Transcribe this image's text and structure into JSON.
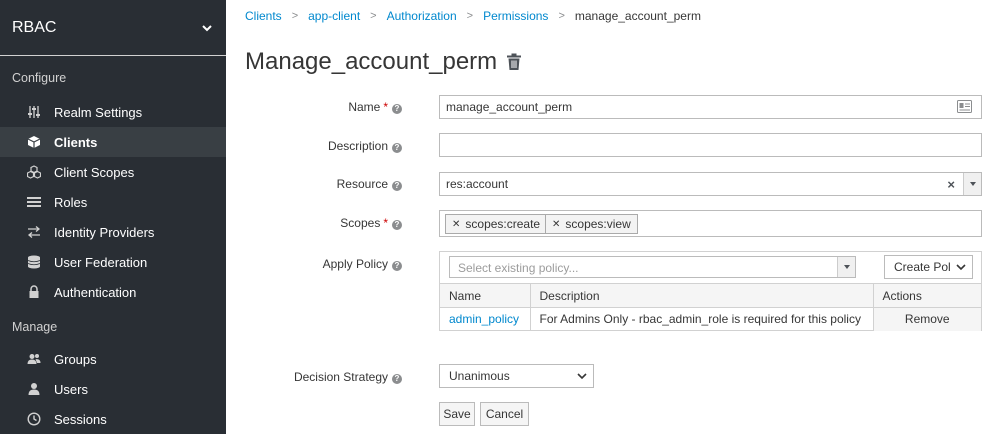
{
  "sidebar": {
    "realm_name": "RBAC",
    "sections": [
      {
        "label": "Configure"
      },
      {
        "label": "Manage"
      }
    ],
    "configure_items": [
      {
        "label": "Realm Settings",
        "icon": "sliders-icon"
      },
      {
        "label": "Clients",
        "icon": "cube-icon",
        "active": true
      },
      {
        "label": "Client Scopes",
        "icon": "cubes-icon"
      },
      {
        "label": "Roles",
        "icon": "list-icon"
      },
      {
        "label": "Identity Providers",
        "icon": "exchange-icon"
      },
      {
        "label": "User Federation",
        "icon": "database-icon"
      },
      {
        "label": "Authentication",
        "icon": "lock-icon"
      }
    ],
    "manage_items": [
      {
        "label": "Groups",
        "icon": "users-icon"
      },
      {
        "label": "Users",
        "icon": "user-icon"
      },
      {
        "label": "Sessions",
        "icon": "clock-icon"
      }
    ]
  },
  "breadcrumb": [
    "Clients",
    "app-client",
    "Authorization",
    "Permissions",
    "manage_account_perm"
  ],
  "page": {
    "title": "Manage_account_perm"
  },
  "form": {
    "name_label": "Name",
    "name_value": "manage_account_perm",
    "description_label": "Description",
    "description_value": "",
    "resource_label": "Resource",
    "resource_value": "res:account",
    "scopes_label": "Scopes",
    "scopes": [
      "scopes:create",
      "scopes:view"
    ],
    "apply_policy_label": "Apply Policy",
    "policy_placeholder": "Select existing policy...",
    "create_policy_label": "Create Pol",
    "policy_table": {
      "headers": [
        "Name",
        "Description",
        "Actions"
      ],
      "rows": [
        {
          "name": "admin_policy",
          "description": "For Admins Only - rbac_admin_role is required for this policy",
          "action": "Remove"
        }
      ]
    },
    "decision_label": "Decision Strategy",
    "decision_value": "Unanimous",
    "save_label": "Save",
    "cancel_label": "Cancel",
    "required_mark": "*",
    "help_glyph": "?"
  },
  "colors": {
    "sidebar_bg": "#292e34",
    "link": "#0088ce",
    "required": "#cc0000"
  }
}
